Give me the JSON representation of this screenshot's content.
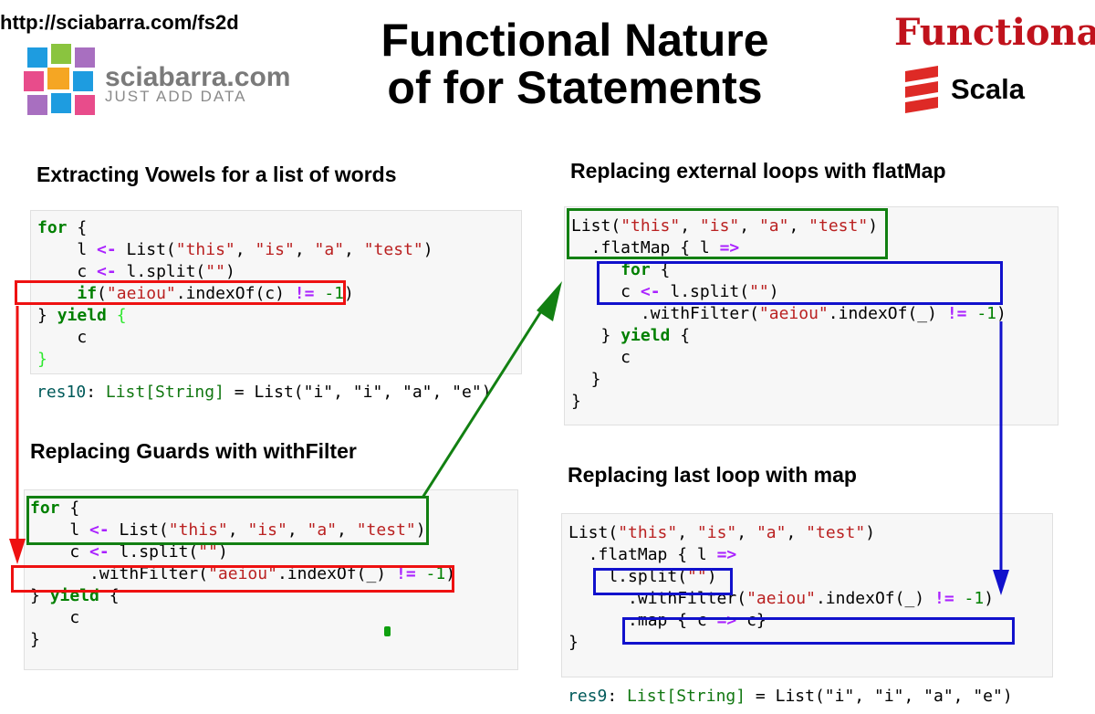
{
  "header": {
    "url": "http://sciabarra.com/fs2d",
    "title_line1": "Functional Nature",
    "title_line2": "of for Statements",
    "brand_name": "sciabarra.com",
    "brand_tagline": "JUST ADD DATA",
    "logo_word": "Functionally",
    "logo_lang": "Scala"
  },
  "sections": {
    "vowels_heading": "Extracting Vowels for a list of words",
    "guards_heading": "Replacing Guards with withFilter",
    "flatmap_heading": "Replacing external loops with flatMap",
    "map_heading": "Replacing last loop with map"
  },
  "results": {
    "res10_name": "res10",
    "res9_name": "res9",
    "type": "List[String]",
    "value": "List(\"i\", \"i\", \"a\", \"e\")"
  },
  "colors": {
    "red": "#ee1111",
    "green": "#128012",
    "blue": "#1111cc",
    "logo_red": "#c0121c"
  },
  "icons": [
    "sciabarra-cube-logo-icon",
    "scala-logo-icon",
    "red-arrow-icon",
    "green-arrow-icon",
    "blue-arrow-icon"
  ]
}
